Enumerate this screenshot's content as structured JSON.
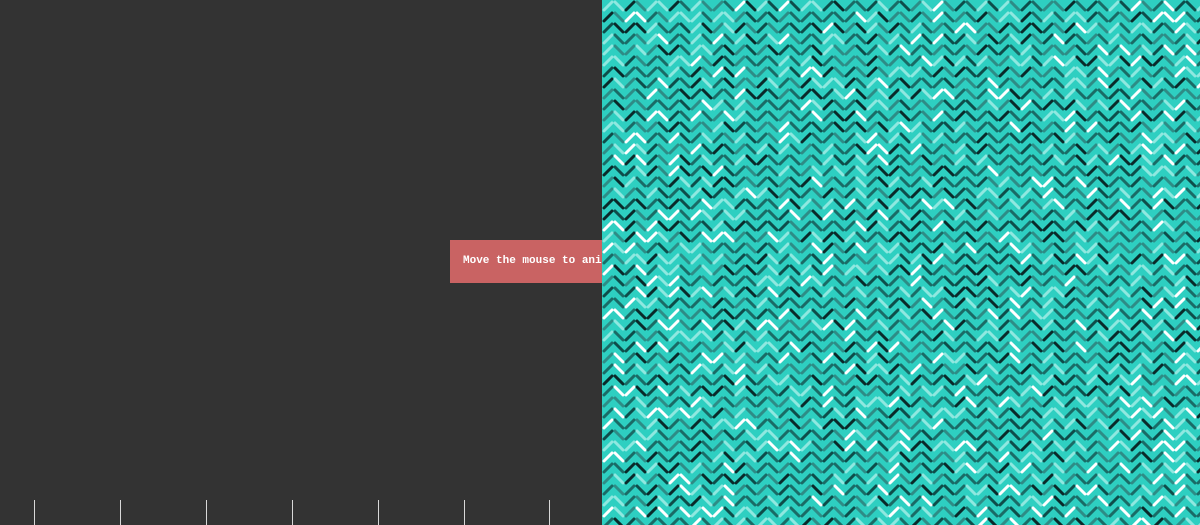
{
  "hint": {
    "text": "Move the mouse to animate"
  },
  "colors": {
    "background": "#333333",
    "hint_bg": "#c96363",
    "hint_text": "#ffffff",
    "pattern_bg": "#2ecfc1",
    "dash_colors": [
      "#0a2a2a",
      "#0e4d4a",
      "#2e8c86",
      "#8fe8e0",
      "#ffffff",
      "#1a6b66"
    ]
  }
}
